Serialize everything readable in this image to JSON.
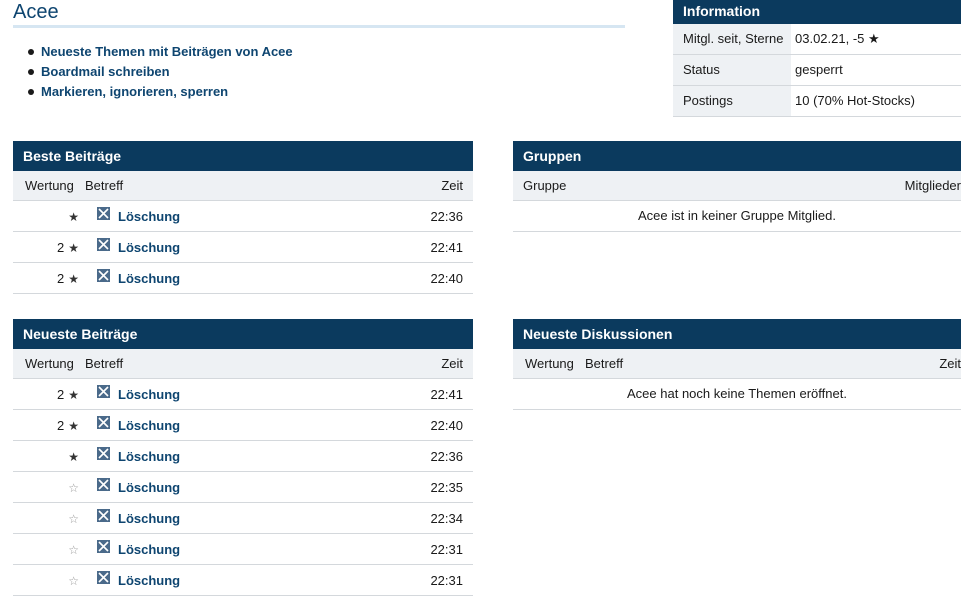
{
  "profile": {
    "username": "Acee"
  },
  "links": [
    {
      "label": "Neueste Themen mit Beiträgen von Acee"
    },
    {
      "label": "Boardmail schreiben"
    },
    {
      "label": "Markieren, ignorieren, sperren"
    }
  ],
  "info": {
    "title": "Information",
    "rows": [
      {
        "label": "Mitgl. seit, Sterne",
        "value": "03.02.21, -5 ★"
      },
      {
        "label": "Status",
        "value": "gesperrt"
      },
      {
        "label": "Postings",
        "value": "10 (70% Hot-Stocks)"
      }
    ]
  },
  "best_posts": {
    "title": "Beste Beiträge",
    "headers": {
      "rating": "Wertung",
      "subject": "Betreff",
      "time": "Zeit"
    },
    "rows": [
      {
        "rating": "",
        "star": "filled",
        "subject": "Löschung",
        "time": "22:36"
      },
      {
        "rating": "2",
        "star": "filled",
        "subject": "Löschung",
        "time": "22:41"
      },
      {
        "rating": "2",
        "star": "filled",
        "subject": "Löschung",
        "time": "22:40"
      }
    ]
  },
  "groups": {
    "title": "Gruppen",
    "headers": {
      "group": "Gruppe",
      "members": "Mitglieder"
    },
    "empty_message": "Acee ist in keiner Gruppe Mitglied."
  },
  "newest_posts": {
    "title": "Neueste Beiträge",
    "headers": {
      "rating": "Wertung",
      "subject": "Betreff",
      "time": "Zeit"
    },
    "rows": [
      {
        "rating": "2",
        "star": "filled",
        "subject": "Löschung",
        "time": "22:41"
      },
      {
        "rating": "2",
        "star": "filled",
        "subject": "Löschung",
        "time": "22:40"
      },
      {
        "rating": "",
        "star": "filled",
        "subject": "Löschung",
        "time": "22:36"
      },
      {
        "rating": "",
        "star": "empty",
        "subject": "Löschung",
        "time": "22:35"
      },
      {
        "rating": "",
        "star": "empty",
        "subject": "Löschung",
        "time": "22:34"
      },
      {
        "rating": "",
        "star": "empty",
        "subject": "Löschung",
        "time": "22:31"
      },
      {
        "rating": "",
        "star": "empty",
        "subject": "Löschung",
        "time": "22:31"
      }
    ]
  },
  "newest_discussions": {
    "title": "Neueste Diskussionen",
    "headers": {
      "rating": "Wertung",
      "subject": "Betreff",
      "time": "Zeit"
    },
    "empty_message": "Acee hat noch keine Themen eröffnet."
  },
  "icons": {
    "deleted_post": "x-box-icon",
    "star_filled": "star-filled-icon",
    "star_empty": "star-outline-icon"
  },
  "colors": {
    "header_bg": "#0b3a5e",
    "link": "#0e4570",
    "column_head_bg": "#eef1f4"
  }
}
